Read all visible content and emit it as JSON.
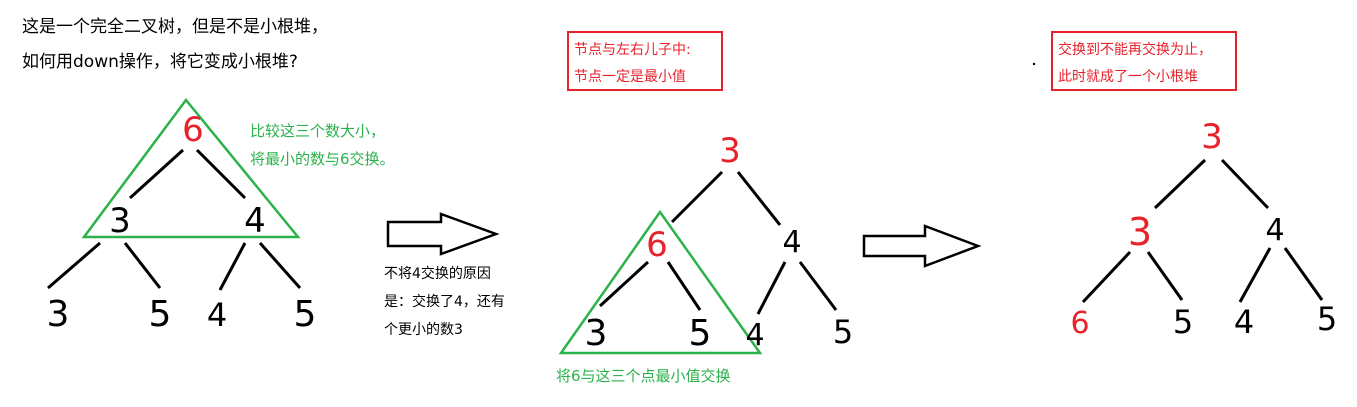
{
  "colors": {
    "black": "#000000",
    "red": "#e8222b",
    "green": "#2bb24c",
    "box": "#e8222b"
  },
  "question": {
    "line1": "这是一个完全二叉树，但是不是小根堆，",
    "line2": "如何用down操作，将它变成小根堆?"
  },
  "tree1": {
    "nodes": {
      "root": "6",
      "left": "3",
      "right": "4",
      "ll": "3",
      "lr": "5",
      "rl": "4",
      "rr": "5"
    },
    "note1": "比较这三个数大小，",
    "note2": "将最小的数与6交换。"
  },
  "middle_note": {
    "line1": "不将4交换的原因",
    "line2": "是：交换了4，还有",
    "line3": "个更小的数3"
  },
  "box2": {
    "line1": "节点与左右儿子中:",
    "line2": "节点一定是最小值"
  },
  "tree2": {
    "nodes": {
      "root": "3",
      "left": "6",
      "right": "4",
      "ll": "3",
      "lr": "5",
      "rl": "4",
      "rr": "5"
    },
    "note": "将6与这三个点最小值交换"
  },
  "box3": {
    "line1": "交换到不能再交换为止，",
    "line2": "此时就成了一个小根堆"
  },
  "tree3": {
    "nodes": {
      "root": "3",
      "left": "3",
      "right": "4",
      "ll": "6",
      "lr": "5",
      "rl": "4",
      "rr": "5"
    }
  }
}
